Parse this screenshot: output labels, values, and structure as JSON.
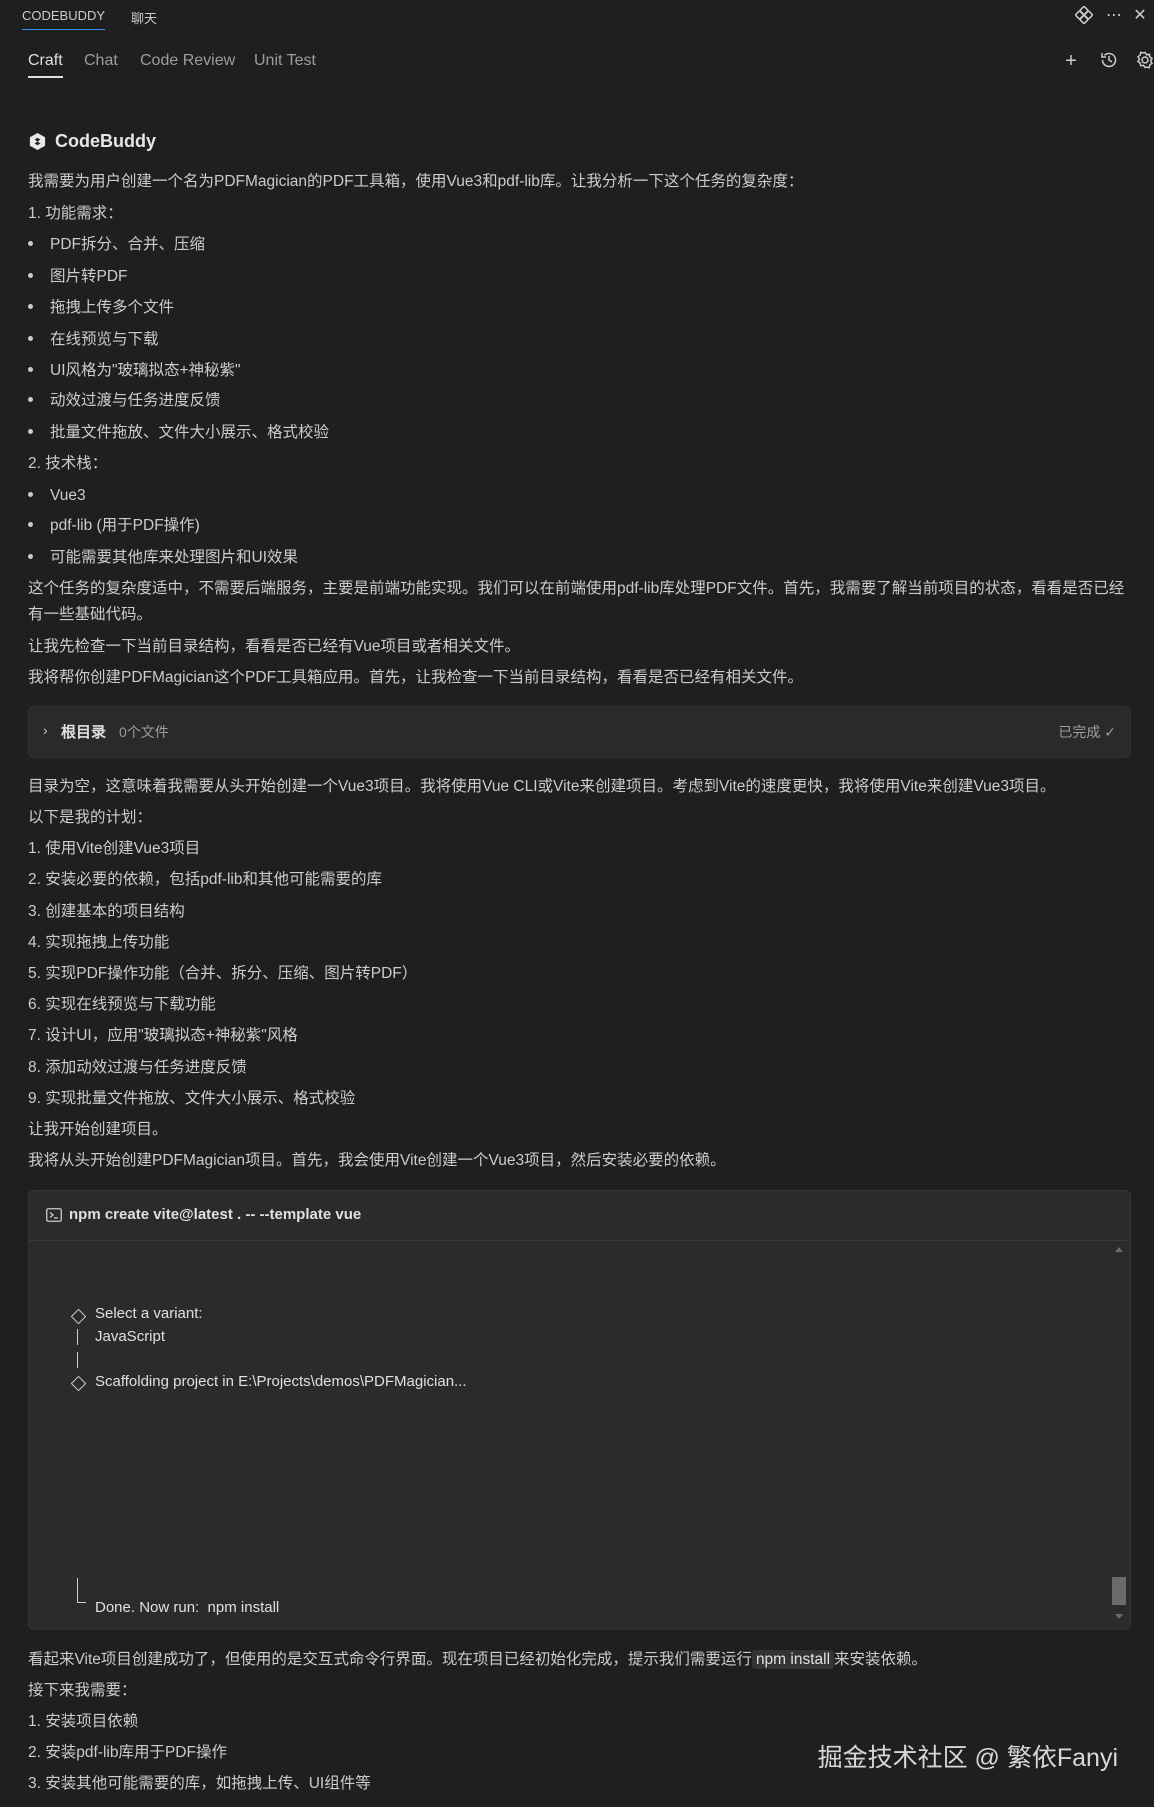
{
  "topbar": {
    "tab_codebuddy": "CODEBUDDY",
    "tab_chat": "聊天",
    "icons": [
      "extension-icon",
      "more-icon",
      "close-icon"
    ]
  },
  "subtabs": {
    "craft": "Craft",
    "chat": "Chat",
    "code_review": "Code Review",
    "unit_test": "Unit Test",
    "icons": [
      "add-icon",
      "history-icon",
      "settings-icon"
    ]
  },
  "brand": {
    "name": "CodeBuddy"
  },
  "message": {
    "intro": "我需要为用户创建一个名为PDFMagician的PDF工具箱，使用Vue3和pdf-lib库。让我分析一下这个任务的复杂度：",
    "req_title": "1. 功能需求：",
    "req_items": [
      "PDF拆分、合并、压缩",
      "图片转PDF",
      "拖拽上传多个文件",
      "在线预览与下载",
      "UI风格为\"玻璃拟态+神秘紫\"",
      "动效过渡与任务进度反馈",
      "批量文件拖放、文件大小展示、格式校验"
    ],
    "tech_title": "2. 技术栈：",
    "tech_items": [
      "Vue3",
      "pdf-lib (用于PDF操作)",
      "可能需要其他库来处理图片和UI效果"
    ],
    "analysis": "这个任务的复杂度适中，不需要后端服务，主要是前端功能实现。我们可以在前端使用pdf-lib库处理PDF文件。首先，我需要了解当前项目的状态，看看是否已经有一些基础代码。",
    "check_dir": "让我先检查一下当前目录结构，看看是否已经有Vue项目或者相关文件。",
    "will_help": "我将帮你创建PDFMagician这个PDF工具箱应用。首先，让我检查一下当前目录结构，看看是否已经有相关文件。"
  },
  "folder_card": {
    "label": "根目录",
    "count": "0个文件",
    "status": "已完成"
  },
  "plan": {
    "empty_dir": "目录为空，这意味着我需要从头开始创建一个Vue3项目。我将使用Vue CLI或Vite来创建项目。考虑到Vite的速度更快，我将使用Vite来创建Vue3项目。",
    "title": "以下是我的计划：",
    "steps": [
      "1. 使用Vite创建Vue3项目",
      "2. 安装必要的依赖，包括pdf-lib和其他可能需要的库",
      "3. 创建基本的项目结构",
      "4. 实现拖拽上传功能",
      "5. 实现PDF操作功能（合并、拆分、压缩、图片转PDF）",
      "6. 实现在线预览与下载功能",
      "7. 设计UI，应用\"玻璃拟态+神秘紫\"风格",
      "8. 添加动效过渡与任务进度反馈",
      "9. 实现批量文件拖放、文件大小展示、格式校验"
    ],
    "start": "让我开始创建项目。",
    "from_scratch": "我将从头开始创建PDFMagician项目。首先，我会使用Vite创建一个Vue3项目，然后安装必要的依赖。"
  },
  "terminal": {
    "command": "npm create vite@latest . -- --template vue",
    "select_variant": "Select a variant:",
    "variant": "JavaScript",
    "scaffolding": "Scaffolding project in E:\\Projects\\demos\\PDFMagician...",
    "done": "Done. Now run:  npm install"
  },
  "followup": {
    "before_code": "看起来Vite项目创建成功了，但使用的是交互式命令行界面。现在项目已经初始化完成，提示我们需要运行",
    "code": "npm install",
    "after_code": "来安装依赖。",
    "next": "接下来我需要：",
    "steps": [
      "1. 安装项目依赖",
      "2. 安装pdf-lib库用于PDF操作",
      "3. 安装其他可能需要的库，如拖拽上传、UI组件等"
    ]
  },
  "watermark": "掘金技术社区 @ 繁依Fanyi"
}
